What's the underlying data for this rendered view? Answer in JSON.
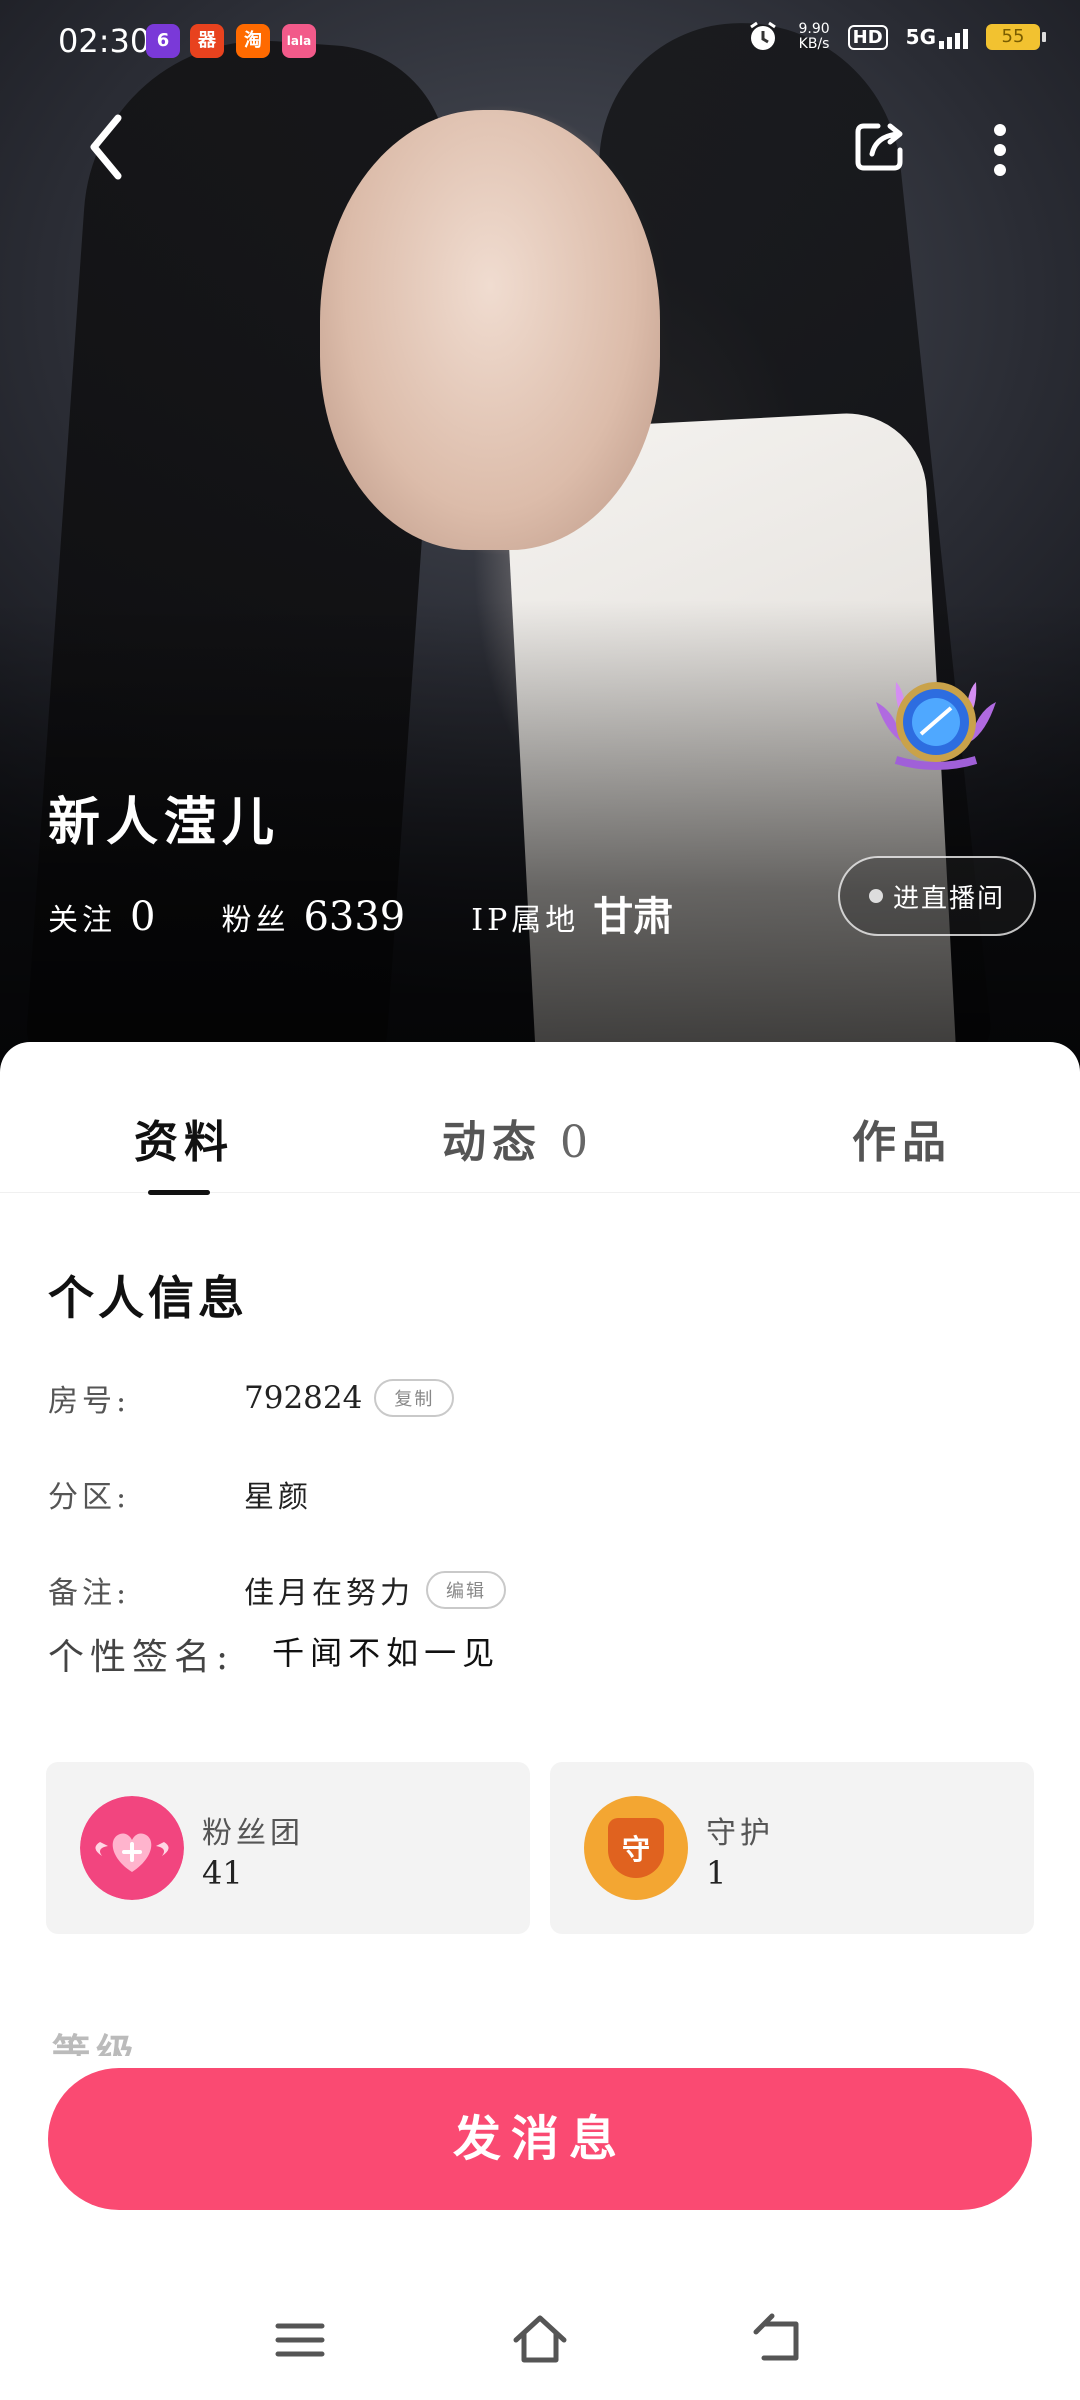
{
  "status_bar": {
    "time": "02:30",
    "apps": [
      "6",
      "器",
      "淘",
      "lala"
    ],
    "net_speed_value": "9.90",
    "net_speed_unit": "KB/s",
    "hd": "HD",
    "signal": "5G",
    "battery": "55"
  },
  "profile": {
    "name": "新人滢儿",
    "follow_label": "关注",
    "follow_count": "0",
    "fans_label": "粉丝",
    "fans_count": "6339",
    "ip_label": "IP属地",
    "ip_value": "甘肃",
    "live_button": "进直播间"
  },
  "tabs": [
    {
      "label": "资料"
    },
    {
      "label": "动态",
      "count": "0"
    },
    {
      "label": "作品"
    }
  ],
  "info": {
    "title": "个人信息",
    "room_label": "房号:",
    "room_value": "792824",
    "copy_label": "复制",
    "zone_label": "分区:",
    "zone_value": "星颜",
    "note_label": "备注:",
    "note_value": "佳月在努力",
    "edit_label": "编辑",
    "signature_label": "个性签名:",
    "signature_value": "千闻不如一见"
  },
  "cards": {
    "fan_club_label": "粉丝团",
    "fan_club_value": "41",
    "guard_label": "守护",
    "guard_icon_text": "守",
    "guard_value": "1"
  },
  "level_title": "等级",
  "send_message": "发消息",
  "colors": {
    "accent": "#fa4a72",
    "card_bg": "#f3f3f3",
    "fan_icon": "#f2457f",
    "guard_icon": "#f3a632"
  }
}
